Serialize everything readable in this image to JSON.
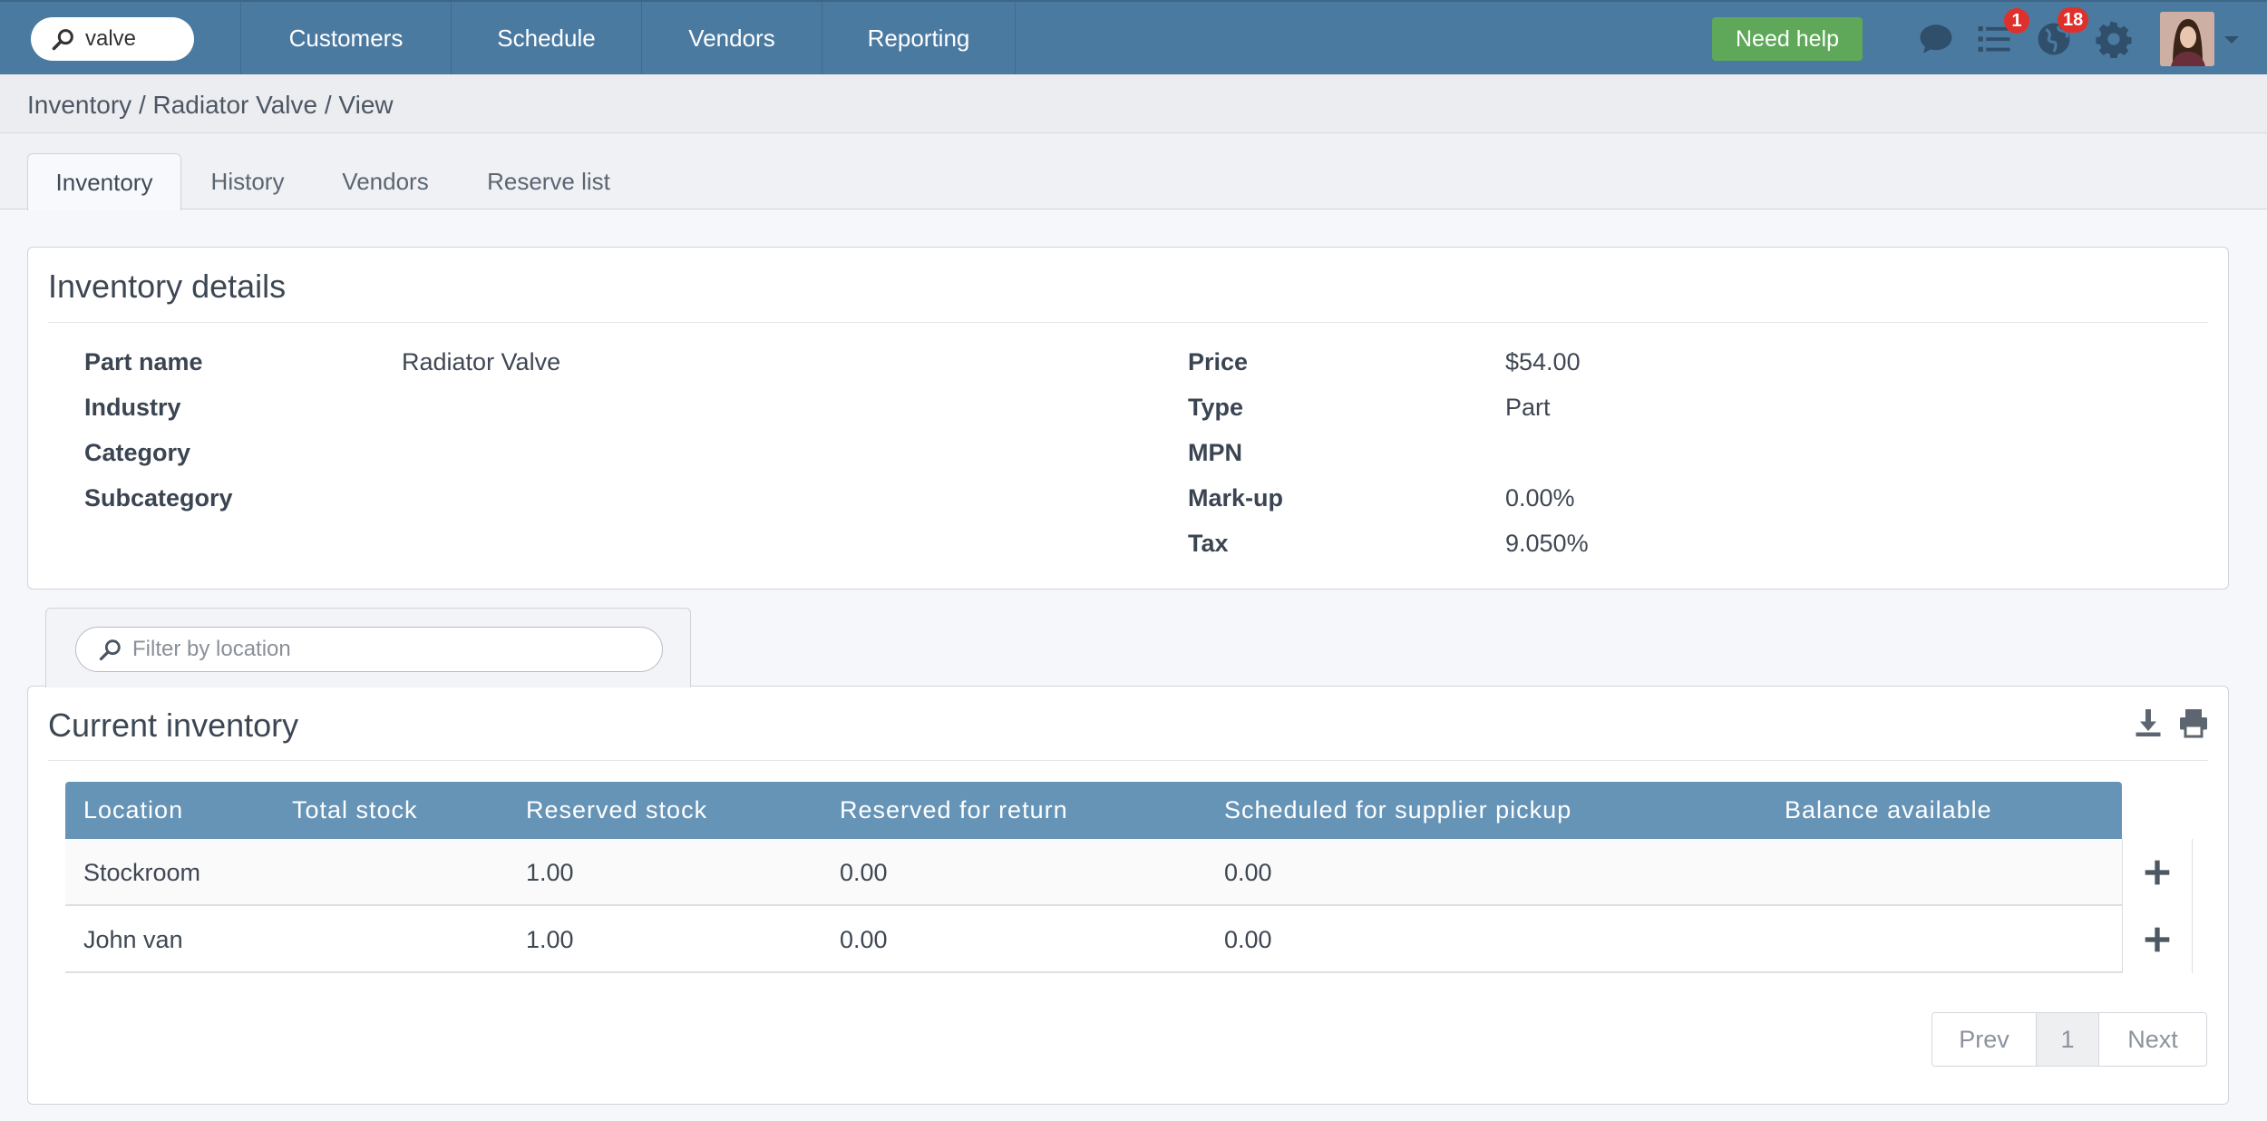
{
  "topbar": {
    "search_value": "valve",
    "search_icon": "search-icon",
    "nav": [
      {
        "label": "Customers"
      },
      {
        "label": "Schedule"
      },
      {
        "label": "Vendors"
      },
      {
        "label": "Reporting"
      }
    ],
    "help_label": "Need help",
    "tasks_badge": "1",
    "globe_badge": "18",
    "colors": {
      "bar": "#4b7aa1",
      "help": "#5fa85a",
      "badge": "#e0302b"
    }
  },
  "breadcrumb": "Inventory / Radiator Valve / View",
  "tabs": [
    {
      "label": "Inventory",
      "active": true
    },
    {
      "label": "History"
    },
    {
      "label": "Vendors"
    },
    {
      "label": "Reserve list"
    }
  ],
  "details": {
    "title": "Inventory details",
    "left": [
      {
        "label": "Part name",
        "value": "Radiator Valve"
      },
      {
        "label": "Industry",
        "value": ""
      },
      {
        "label": "Category",
        "value": ""
      },
      {
        "label": "Subcategory",
        "value": ""
      }
    ],
    "right": [
      {
        "label": "Price",
        "value": "$54.00"
      },
      {
        "label": "Type",
        "value": "Part"
      },
      {
        "label": "MPN",
        "value": ""
      },
      {
        "label": "Mark-up",
        "value": "0.00%"
      },
      {
        "label": "Tax",
        "value": "9.050%"
      }
    ]
  },
  "filter": {
    "placeholder": "Filter by location"
  },
  "inventory": {
    "title": "Current inventory",
    "columns": [
      "Location",
      "Total stock",
      "Reserved stock",
      "Reserved for return",
      "Scheduled for supplier pickup",
      "Balance available"
    ],
    "rows": [
      [
        "Stockroom",
        "",
        "1.00",
        "0.00",
        "0.00",
        ""
      ],
      [
        "John van",
        "",
        "1.00",
        "0.00",
        "0.00",
        ""
      ]
    ]
  },
  "pager": {
    "prev": "Prev",
    "page": "1",
    "next": "Next"
  }
}
